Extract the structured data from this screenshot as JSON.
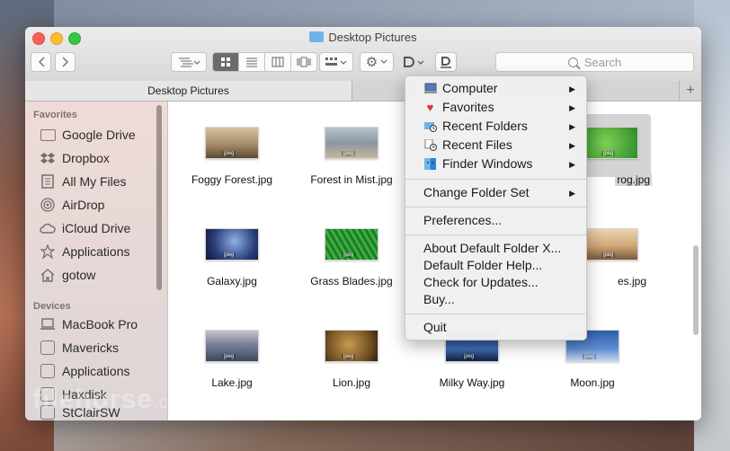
{
  "window": {
    "title": "Desktop Pictures"
  },
  "toolbar": {
    "search_placeholder": "Search",
    "view_modes": [
      "icon-view",
      "list-view",
      "column-view",
      "cover-flow-view"
    ]
  },
  "tabs": [
    {
      "label": "Desktop Pictures"
    }
  ],
  "sidebar": {
    "favorites_header": "Favorites",
    "favorites": [
      {
        "label": "Google Drive",
        "icon": "folder-icon"
      },
      {
        "label": "Dropbox",
        "icon": "dropbox-icon"
      },
      {
        "label": "All My Files",
        "icon": "all-files-icon"
      },
      {
        "label": "AirDrop",
        "icon": "airdrop-icon"
      },
      {
        "label": "iCloud Drive",
        "icon": "cloud-icon"
      },
      {
        "label": "Applications",
        "icon": "applications-icon"
      },
      {
        "label": "gotow",
        "icon": "home-icon"
      }
    ],
    "devices_header": "Devices",
    "devices": [
      {
        "label": "MacBook Pro",
        "icon": "laptop-icon"
      },
      {
        "label": "Mavericks",
        "icon": "disk-icon"
      },
      {
        "label": "Applications",
        "icon": "disk-icon"
      },
      {
        "label": "Haxdisk",
        "icon": "disk-icon"
      },
      {
        "label": "StClairSW",
        "icon": "disk-icon"
      }
    ]
  },
  "files": [
    {
      "name": "Foggy Forest.jpg"
    },
    {
      "name": "Forest in Mist.jpg"
    },
    {
      "name": "rog.jpg"
    },
    {
      "name": "Galaxy.jpg"
    },
    {
      "name": "Grass Blades.jpg"
    },
    {
      "name": "es.jpg"
    },
    {
      "name": "Lake.jpg"
    },
    {
      "name": "Lion.jpg"
    },
    {
      "name": "Milky Way.jpg"
    },
    {
      "name": "Moon.jpg"
    }
  ],
  "thumb_badge": "jpeg",
  "menu": {
    "items": [
      {
        "label": "Computer",
        "icon": "computer-icon",
        "submenu": true
      },
      {
        "label": "Favorites",
        "icon": "heart-icon",
        "submenu": true
      },
      {
        "label": "Recent Folders",
        "icon": "recent-folders-icon",
        "submenu": true
      },
      {
        "label": "Recent Files",
        "icon": "recent-files-icon",
        "submenu": true
      },
      {
        "label": "Finder Windows",
        "icon": "finder-icon",
        "submenu": true
      },
      {
        "label": "Change Folder Set",
        "submenu": true
      },
      {
        "label": "Preferences..."
      },
      {
        "label": "About Default Folder X..."
      },
      {
        "label": "Default Folder Help..."
      },
      {
        "label": "Check for Updates..."
      },
      {
        "label": "Buy..."
      },
      {
        "label": "Quit"
      }
    ],
    "submenu_arrow": "▶"
  },
  "watermark": {
    "main": "filehorse",
    "suffix": ".com"
  }
}
